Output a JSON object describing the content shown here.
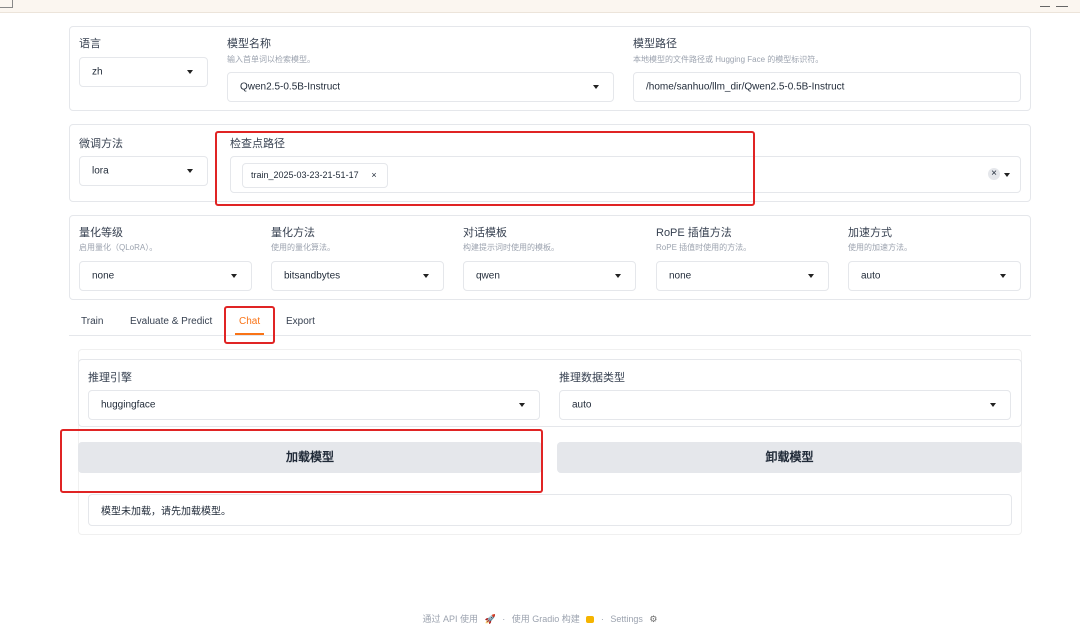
{
  "model": {
    "language_label": "语言",
    "language_value": "zh",
    "model_name_label": "模型名称",
    "model_name_hint": "输入首单词以检索模型。",
    "model_name_value": "Qwen2.5-0.5B-Instruct",
    "model_path_label": "模型路径",
    "model_path_hint": "本地模型的文件路径或 Hugging Face 的模型标识符。",
    "model_path_value": "/home/sanhuo/llm_dir/Qwen2.5-0.5B-Instruct"
  },
  "finetune": {
    "method_label": "微调方法",
    "method_value": "lora",
    "checkpoint_label": "检查点路径",
    "checkpoint_tag": "train_2025-03-23-21-51-17"
  },
  "advanced": {
    "quant_level_label": "量化等级",
    "quant_level_hint": "启用量化（QLoRA）。",
    "quant_level_value": "none",
    "quant_method_label": "量化方法",
    "quant_method_hint": "使用的量化算法。",
    "quant_method_value": "bitsandbytes",
    "template_label": "对话模板",
    "template_hint": "构建提示词时使用的模板。",
    "template_value": "qwen",
    "rope_label": "RoPE 插值方法",
    "rope_hint": "RoPE 插值时使用的方法。",
    "rope_value": "none",
    "accel_label": "加速方式",
    "accel_hint": "使用的加速方法。",
    "accel_value": "auto"
  },
  "tabs": [
    "Train",
    "Evaluate & Predict",
    "Chat",
    "Export"
  ],
  "active_tab": "Chat",
  "chat": {
    "engine_label": "推理引擎",
    "engine_value": "huggingface",
    "dtype_label": "推理数据类型",
    "dtype_value": "auto",
    "load_button": "加载模型",
    "unload_button": "卸载模型",
    "status_text": "模型未加载，请先加载模型。"
  },
  "footer": {
    "api": "通过 API 使用",
    "gradio": "使用 Gradio 构建",
    "settings": "Settings",
    "sep": "·"
  },
  "colors": {
    "accent": "#f97316",
    "highlight": "#e02424"
  }
}
